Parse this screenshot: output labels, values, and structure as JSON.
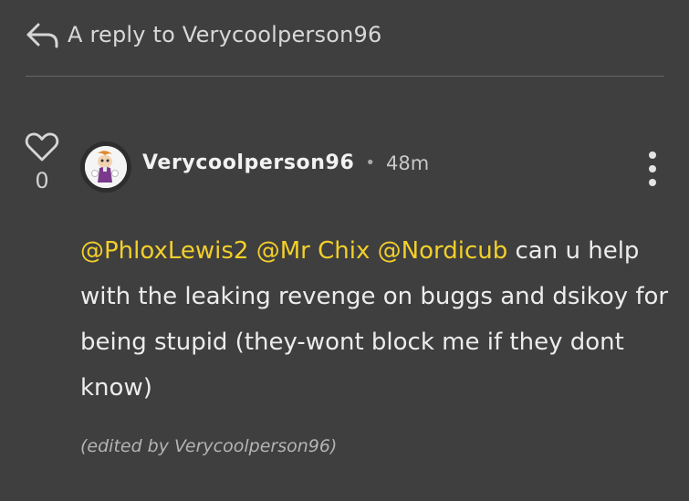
{
  "reply_header": {
    "text": "A reply to Verycoolperson96",
    "icon": "reply-arrow-icon"
  },
  "vote": {
    "icon": "heart-icon",
    "count": "0"
  },
  "post": {
    "author": "Verycoolperson96",
    "separator": "•",
    "timestamp": "48m",
    "menu_icon": "more-vertical-icon",
    "mentions": [
      "@PhloxLewis2",
      "@Mr Chix",
      "@Nordicub"
    ],
    "body_text": "can u help with the leaking revenge on buggs and dsikoy for being stupid (they-wont block me if they dont know)",
    "edited_note": "(edited by Verycoolperson96)"
  },
  "colors": {
    "background": "#3f3f3f",
    "mention": "#f2cf2b",
    "divider": "#666666"
  }
}
